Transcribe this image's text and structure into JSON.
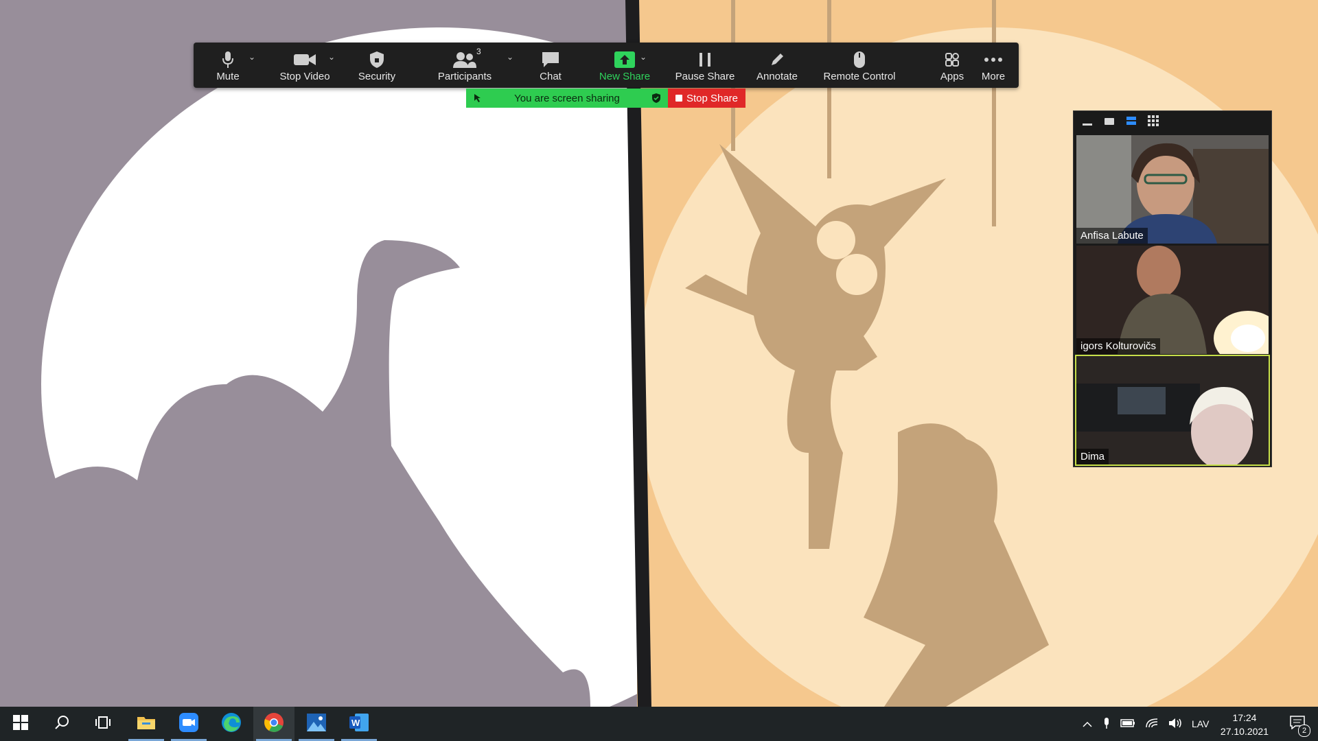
{
  "toolbar": {
    "mute": "Mute",
    "stop_video": "Stop Video",
    "security": "Security",
    "participants": "Participants",
    "participants_count": "3",
    "chat": "Chat",
    "new_share": "New Share",
    "pause_share": "Pause Share",
    "annotate": "Annotate",
    "remote_control": "Remote Control",
    "apps": "Apps",
    "more": "More"
  },
  "sharing": {
    "banner": "You are screen sharing",
    "stop_share": "Stop Share"
  },
  "participants": [
    {
      "name": "Anfisa Labute"
    },
    {
      "name": "igors Kolturovičs"
    },
    {
      "name": "Dima"
    }
  ],
  "taskbar": {
    "language": "LAV",
    "time": "17:24",
    "date": "27.10.2021",
    "notifications": "2"
  },
  "colors": {
    "toolbar_bg": "#1f1f1f",
    "share_green": "#2ecc50",
    "stop_red": "#e02828",
    "left_bg": "#988e9a",
    "right_bg": "#f5c88e"
  }
}
